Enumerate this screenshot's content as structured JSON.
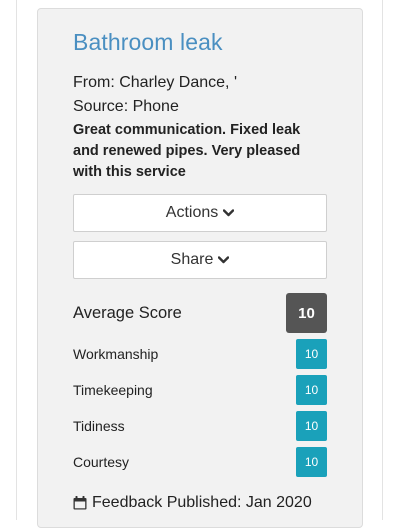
{
  "review": {
    "title": "Bathroom leak",
    "from": "From: Charley Dance, '",
    "source": "Source: Phone",
    "comment": "Great communication. Fixed leak and renewed pipes. Very pleased with this service"
  },
  "buttons": {
    "actions_label": "Actions",
    "share_label": "Share"
  },
  "scores": {
    "average_label": "Average Score",
    "average_value": "10",
    "items": [
      {
        "label": "Workmanship",
        "value": "10"
      },
      {
        "label": "Timekeeping",
        "value": "10"
      },
      {
        "label": "Tidiness",
        "value": "10"
      },
      {
        "label": "Courtesy",
        "value": "10"
      }
    ]
  },
  "footer": {
    "published_text": "Feedback Published: Jan 2020",
    "icon": "calendar-icon"
  },
  "colors": {
    "title": "#4a8fc1",
    "average_badge": "#555555",
    "score_badge": "#1aa1ba",
    "card_background": "#f2f2f2"
  }
}
